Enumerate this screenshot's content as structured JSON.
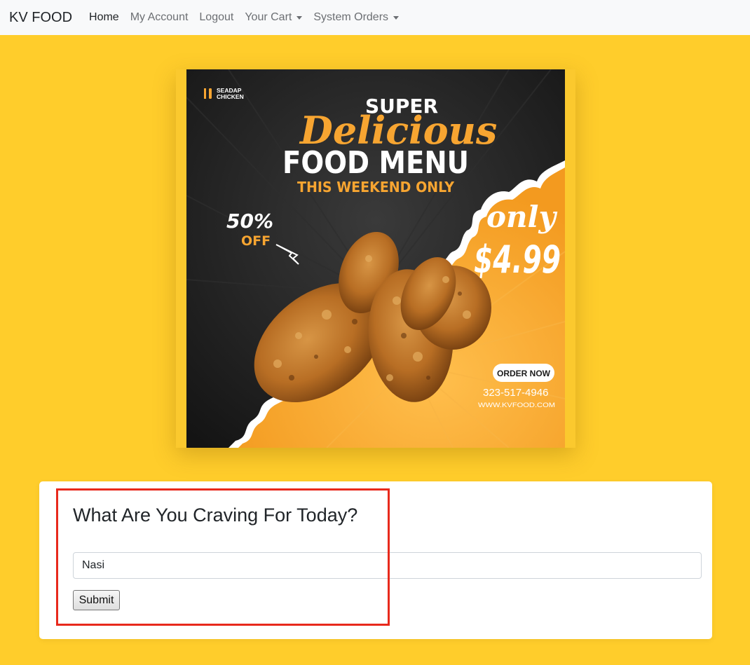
{
  "navbar": {
    "brand": "KV FOOD",
    "links": [
      {
        "label": "Home",
        "active": true,
        "dropdown": false
      },
      {
        "label": "My Account",
        "active": false,
        "dropdown": false
      },
      {
        "label": "Logout",
        "active": false,
        "dropdown": false
      },
      {
        "label": "Your Cart",
        "active": false,
        "dropdown": true
      },
      {
        "label": "System Orders",
        "active": false,
        "dropdown": true
      }
    ]
  },
  "banner": {
    "logo_line1": "SEADAP",
    "logo_line2": "CHICKEN",
    "super": "SUPER",
    "delicious": "Delicious",
    "food_menu": "FOOD MENU",
    "weekend": "THIS WEEKEND ONLY",
    "discount": "50%",
    "off": "OFF",
    "only": "only",
    "price": "$4.99",
    "order_now": "ORDER NOW",
    "phone": "323-517-4946",
    "website": "WWW.KVFOOD.COM"
  },
  "form": {
    "title": "What Are You Craving For Today?",
    "input_value": "Nasi",
    "submit_label": "Submit"
  },
  "colors": {
    "page_background": "#ffcd2b",
    "banner_orange": "#f7a531",
    "banner_dark": "#1c1c1c",
    "highlight": "#e8291c"
  }
}
